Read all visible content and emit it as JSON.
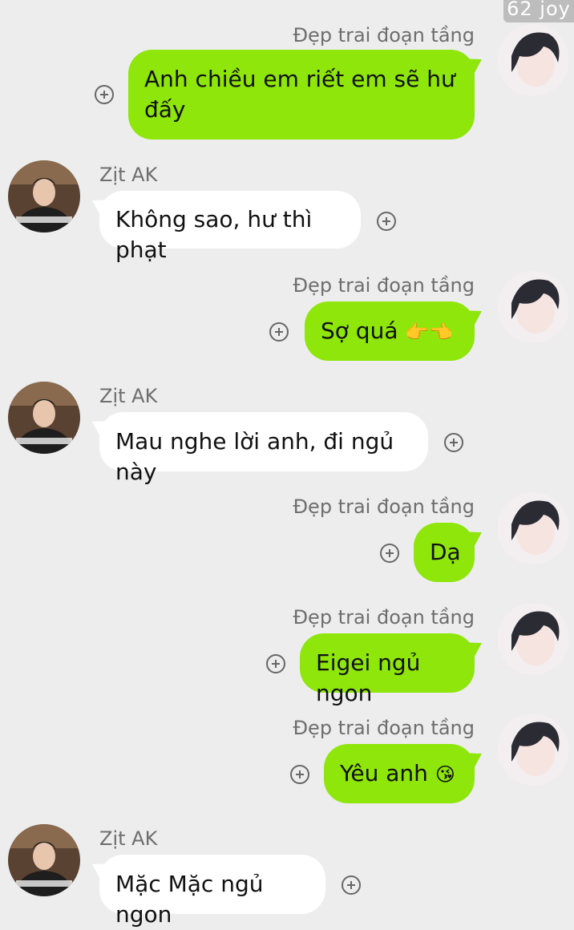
{
  "watermark": "62 joy",
  "contacts": {
    "me": {
      "name": "Đẹp trai đoạn tầng"
    },
    "other": {
      "name": "Zịt AK"
    }
  },
  "icons": {
    "add": "plus-circle-icon",
    "avatar_me": "avatar-me",
    "avatar_other": "avatar-other"
  },
  "colors": {
    "sent_bubble": "#8ee60a",
    "received_bubble": "#ffffff",
    "background": "#ededed"
  },
  "messages": [
    {
      "sender": "Đẹp trai đoạn tầng",
      "line1": "Anh chiều em riết em sẽ hư",
      "line2": "đấy"
    },
    {
      "sender": "Zịt AK",
      "text": "Không sao, hư thì phạt"
    },
    {
      "sender": "Đẹp trai đoạn tầng",
      "text": "Sợ quá",
      "emoji": "👉👈"
    },
    {
      "sender": "Zịt AK",
      "text": "Mau nghe lời anh, đi ngủ này"
    },
    {
      "sender": "Đẹp trai đoạn tầng",
      "text": "Dạ"
    },
    {
      "sender": "Đẹp trai đoạn tầng",
      "text": "Eigei ngủ ngon"
    },
    {
      "sender": "Đẹp trai đoạn tầng",
      "text": "Yêu anh",
      "emoji": "😘"
    },
    {
      "sender": "Zịt AK",
      "text": "Mặc Mặc ngủ ngon"
    }
  ]
}
